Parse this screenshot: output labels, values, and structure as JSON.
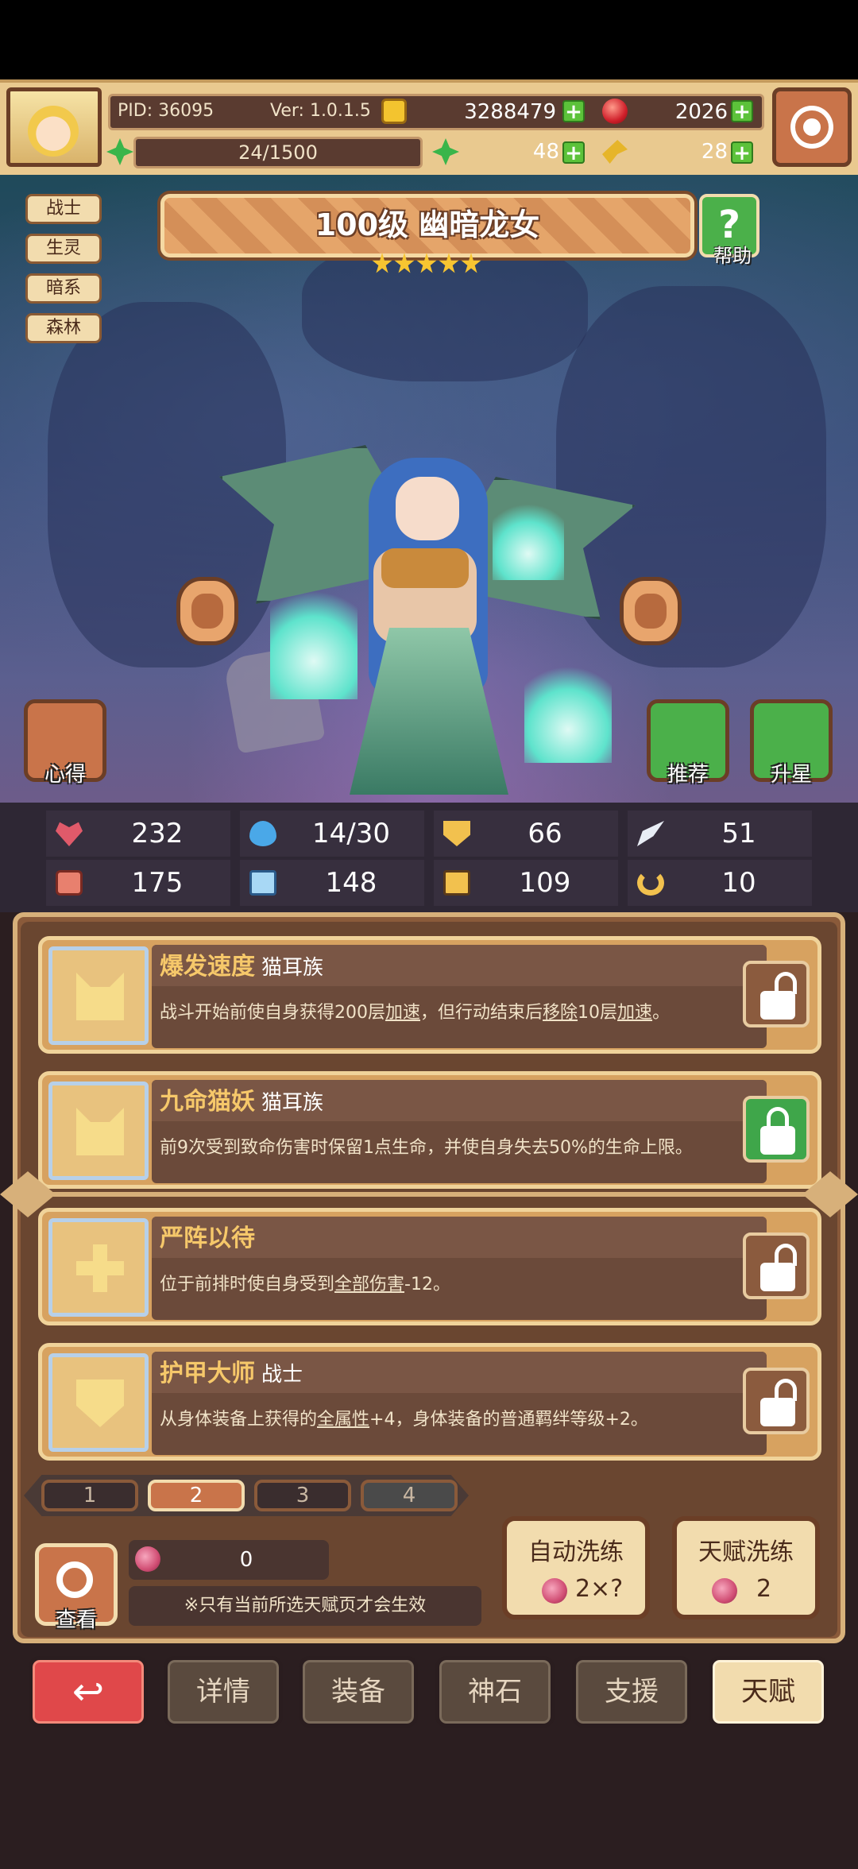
{
  "top": {
    "pid": "PID: 36095",
    "version": "Ver: 1.0.1.5",
    "gold": "3288479",
    "gems": "2026",
    "energy": "24/1500",
    "clover": "48",
    "keys": "28"
  },
  "hero": {
    "title": "100级  幽暗龙女",
    "stars": 5,
    "tags": [
      "战士",
      "生灵",
      "暗系",
      "森林"
    ],
    "help_label": "帮助",
    "left_button": "心得",
    "recommend_label": "推荐",
    "upgrade_label": "升星"
  },
  "stats": [
    {
      "icon": "heart-icon",
      "value": "232"
    },
    {
      "icon": "drop-icon",
      "value": "14/30"
    },
    {
      "icon": "shield-icon",
      "value": "66"
    },
    {
      "icon": "wing-icon",
      "value": "51"
    },
    {
      "icon": "fist-icon",
      "value": "175"
    },
    {
      "icon": "book-icon",
      "value": "148"
    },
    {
      "icon": "boot-icon",
      "value": "109"
    },
    {
      "icon": "horseshoe-icon",
      "value": "10"
    }
  ],
  "talents": [
    {
      "name": "爆发速度",
      "race": "猫耳族",
      "desc_pre": "战斗开始前使自身获得200层",
      "u1": "加速",
      "desc_mid": "，但行动结束后",
      "u2": "移除",
      "desc_mid2": "10层",
      "u3": "加速",
      "desc_post": "。",
      "locked": false
    },
    {
      "name": "九命猫妖",
      "race": "猫耳族",
      "desc": "前9次受到致命伤害时保留1点生命，并使自身失去50%的生命上限。",
      "locked": true
    },
    {
      "name": "严阵以待",
      "race": "",
      "desc_pre": "位于前排时使自身受到",
      "u1": "全部伤害",
      "desc_post": "-12。",
      "locked": false
    },
    {
      "name": "护甲大师",
      "race": "战士",
      "desc_pre": "从身体装备上获得的",
      "u1": "全属性",
      "desc_post": "+4，身体装备的普通羁绊等级+2。",
      "locked": false
    }
  ],
  "pages": [
    "1",
    "2",
    "3",
    "4"
  ],
  "active_page": "2",
  "bottom": {
    "view_label": "查看",
    "fruit_count": "0",
    "note": "※只有当前所选天赋页才会生效",
    "auto_reroll_label": "自动洗练",
    "auto_reroll_cost": "2×?",
    "talent_reroll_label": "天赋洗练",
    "talent_reroll_cost": "2"
  },
  "nav": [
    "详情",
    "装备",
    "神石",
    "支援",
    "天赋"
  ],
  "colors": {
    "accent": "#c9744a",
    "banner": "#e5a56a",
    "lock_green": "#3fa64a"
  }
}
